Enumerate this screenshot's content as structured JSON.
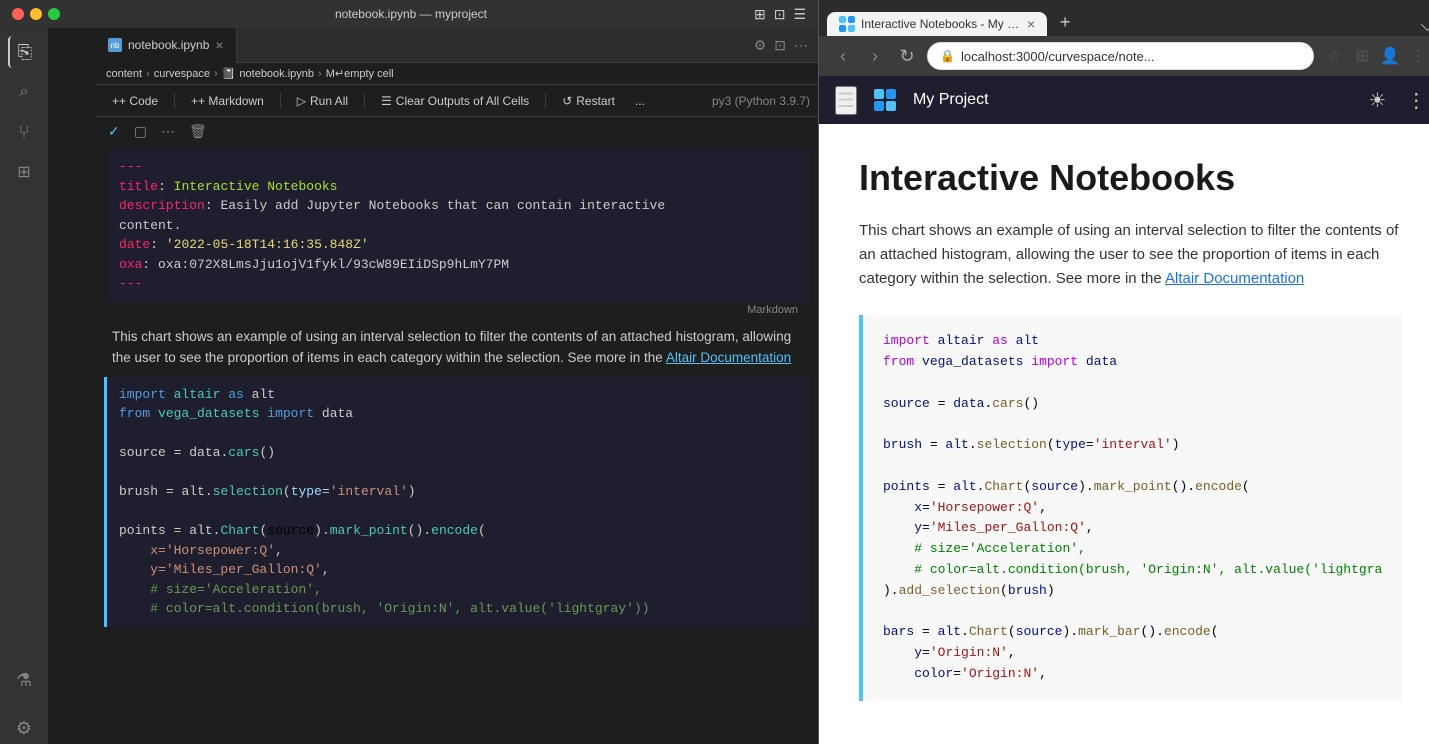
{
  "vscode": {
    "titlebar": {
      "title": "notebook.ipynb — myproject",
      "icons": [
        "⊞",
        "⊡",
        "☰"
      ]
    },
    "tab": {
      "filename": "notebook.ipynb",
      "icon_text": "nb"
    },
    "breadcrumb": {
      "parts": [
        "content",
        "curvespace",
        "notebook.ipynb",
        "M↵empty cell"
      ]
    },
    "toolbar": {
      "code_label": "+ Code",
      "markdown_label": "+ Markdown",
      "run_all_label": "Run All",
      "clear_outputs_label": "Clear Outputs of All Cells",
      "restart_label": "Restart",
      "more_label": "...",
      "kernel_label": "py3 (Python 3.9.7)"
    },
    "cell_toolbar": {
      "check": "✓",
      "square": "▢",
      "more": "...",
      "delete": "🗑"
    },
    "frontmatter": {
      "separator": "---",
      "title_key": "title:",
      "title_val": "Interactive Notebooks",
      "desc_key": "description:",
      "desc_val": "Easily add Jupyter Notebooks that can contain interactive",
      "desc_val2": "content.",
      "date_key": "date:",
      "date_val": "'2022-05-18T14:16:35.848Z'",
      "oxa_key": "oxa:",
      "oxa_val": "oxa:072X8LmsJju1ojV1fykl/93cW89EIiDSp9hLmY7PM",
      "separator2": "---"
    },
    "markdown_label": "Markdown",
    "markdown_text": "This chart shows an example of using an interval selection to filter the contents of an attached histogram, allowing the user to see the proportion of items in each category within the selection. See more in the",
    "markdown_link": "Altair Documentation",
    "code_lines": [
      "import altair as alt",
      "from vega_datasets import data",
      "",
      "source = data.cars()",
      "",
      "brush = alt.selection(type='interval')",
      "",
      "points = alt.Chart(source).mark_point().encode(",
      "    x='Horsepower:Q',",
      "    y='Miles_per_Gallon:Q',",
      "    # size='Acceleration',",
      "    # color=alt.condition(brush, 'Origin:N', alt.value('lightgray'))"
    ]
  },
  "browser": {
    "tab_title": "Interactive Notebooks - My Pr...",
    "url": "localhost:3000/curvespace/note...",
    "app_title": "My Project",
    "content": {
      "heading": "Interactive Notebooks",
      "description": "This chart shows an example of using an interval selection to filter the contents of an attached histogram, allowing the user to see the proportion of items in each category within the selection. See more in the",
      "doc_link": "Altair Documentation",
      "code_lines": [
        "import altair as alt",
        "from vega_datasets import data",
        "",
        "source = data.cars()",
        "",
        "brush = alt.selection(type='interval')",
        "",
        "points = alt.Chart(source).mark_point().encode(",
        "    x='Horsepower:Q',",
        "    y='Miles_per_Gallon:Q',",
        "    # size='Acceleration',",
        "    # color=alt.condition(brush, 'Origin:N', alt.value('lightgra",
        ").add_selection(brush)",
        "",
        "bars = alt.Chart(source).mark_bar().encode(",
        "    y='Origin:N',",
        "    color='Origin:N',"
      ]
    }
  },
  "sidebar": {
    "icons": [
      {
        "name": "files-icon",
        "glyph": "⎘"
      },
      {
        "name": "search-icon",
        "glyph": "🔍"
      },
      {
        "name": "source-control-icon",
        "glyph": "⑂"
      },
      {
        "name": "extensions-icon",
        "glyph": "⊞"
      },
      {
        "name": "flask-icon",
        "glyph": "⚗"
      },
      {
        "name": "settings-icon",
        "glyph": "⚙"
      }
    ]
  }
}
